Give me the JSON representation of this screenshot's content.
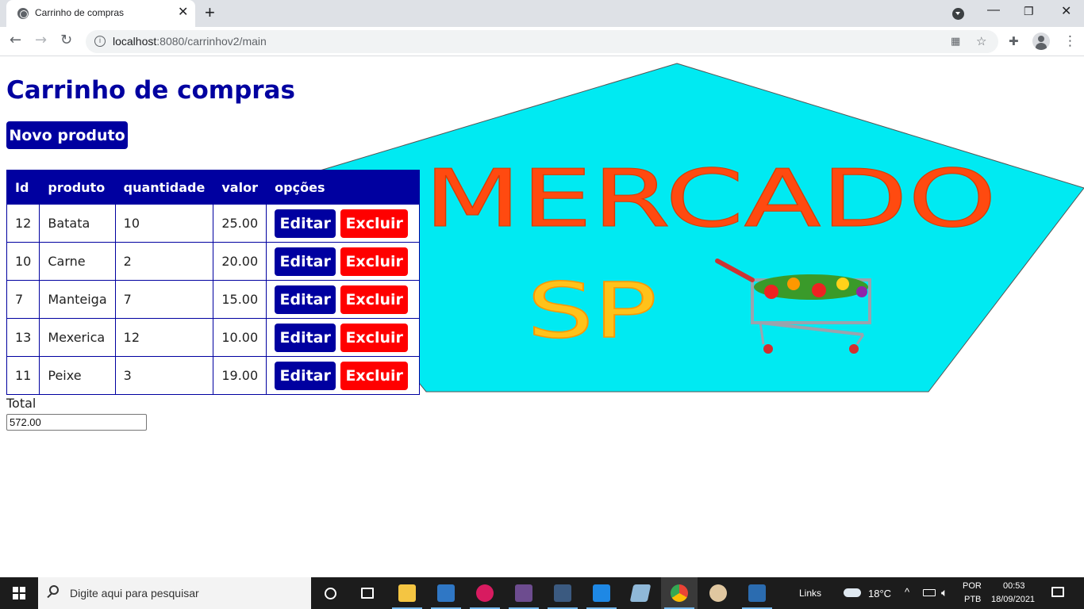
{
  "browser": {
    "tab_title": "Carrinho de compras",
    "tab_close": "✕",
    "new_tab": "+",
    "url_host": "localhost",
    "url_path": ":8080/carrinhov2/main",
    "window_controls": {
      "minimize": "—",
      "maximize": "❐",
      "close": "✕"
    }
  },
  "page": {
    "title": "Carrinho de compras",
    "new_product_label": "Novo produto",
    "table": {
      "headers": [
        "Id",
        "produto",
        "quantidade",
        "valor",
        "opções"
      ],
      "rows": [
        {
          "id": "12",
          "produto": "Batata",
          "quantidade": "10",
          "valor": "25.00"
        },
        {
          "id": "10",
          "produto": "Carne",
          "quantidade": "2",
          "valor": "20.00"
        },
        {
          "id": "7",
          "produto": "Manteiga",
          "quantidade": "7",
          "valor": "15.00"
        },
        {
          "id": "13",
          "produto": "Mexerica",
          "quantidade": "12",
          "valor": "10.00"
        },
        {
          "id": "11",
          "produto": "Peixe",
          "quantidade": "3",
          "valor": "19.00"
        }
      ],
      "edit_label": "Editar",
      "delete_label": "Excluir"
    },
    "total_label": "Total",
    "total_value": "572.00",
    "banner": {
      "line1": "MERCADO",
      "line2": "SP"
    }
  },
  "colors": {
    "primary": "#0000a0",
    "danger": "#ff0000",
    "banner_bg": "#00eaf2",
    "banner_text": "#ff4a10"
  },
  "taskbar": {
    "search_placeholder": "Digite aqui para pesquisar",
    "links_label": "Links",
    "temperature": "18°C",
    "language_1": "POR",
    "language_2": "PTB",
    "time": "00:53",
    "date": "18/09/2021"
  }
}
